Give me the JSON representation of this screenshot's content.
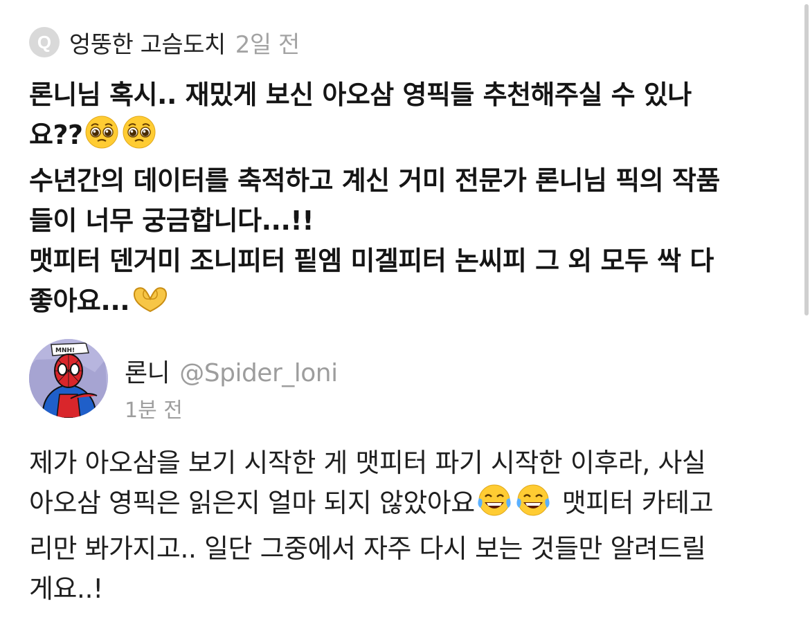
{
  "question": {
    "badge_letter": "Q",
    "asker_name": "엉뚱한 고슴도치",
    "time": "2일 전",
    "lines": [
      "론니님 혹시.. 재밌게 보신 아오삼 영픽들 추천해주실 수 있나",
      "요??",
      "수년간의 데이터를 축적하고 계신 거미 전문가 론니님 픽의 작품",
      "들이 너무 궁금합니다...!!",
      "맷피터 덴거미 조니피터 핕엠 미겔피터 논씨피 그 외 모두 싹 다",
      "좋아요..."
    ]
  },
  "answer": {
    "name": "론니",
    "handle": "@Spider_loni",
    "time": "1분 전",
    "lines": [
      "제가 아오삼을 보기 시작한 게 맷피터 파기 시작한 이후라, 사실",
      "아오삼 영픽은 읽은지 얼마 되지 않았아요",
      "맷피터 카테고",
      "리만 봐가지고.. 일단 그중에서 자주 다시 보는 것들만 알려드릴",
      "게요..!"
    ]
  },
  "icons": {
    "badge": "q-badge-icon",
    "pleading": "pleading-face-icon",
    "heart_hands": "heart-hands-icon",
    "laughing": "tears-of-joy-icon",
    "avatar": "spiderman-avatar"
  },
  "colors": {
    "badge": "#d9d9d9",
    "muted_text": "#a3a3a3",
    "emoji_yellow": "#ffcc33"
  }
}
